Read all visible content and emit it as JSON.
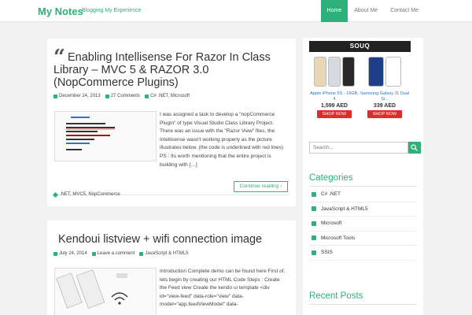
{
  "header": {
    "brand": "My Notes",
    "tagline": "Blogging My Experience",
    "nav": [
      {
        "label": "Home",
        "active": true
      },
      {
        "label": "About Me",
        "active": false
      },
      {
        "label": "Contact Me",
        "active": false
      }
    ]
  },
  "posts": [
    {
      "title": "Enabling Intellisense For Razor In Class Library – MVC 5 & RAZOR 3.0 (NopCommerce Plugins)",
      "date": "December 24, 2013",
      "comments": "27 Comments",
      "categories": "C# .NET, Microsoft",
      "excerpt": "I was assigned a task to develop a \"nopCommerce Plugin\" of type Visual Studio Class Library Project. There was an issue with the \"Razor View\" files, the Intellisense wasn't working properly as the picture illustrates below. (the code is underlined with red lines) PS : Its worth mentioning that the entire project is building with […]",
      "continue_label": "Continue reading",
      "tags": ".NET, MVC5, NopCommerce"
    },
    {
      "title": "Kendoui listview + wifi connection image",
      "date": "July 24, 2014",
      "comments": "Leave a comment",
      "categories": "JavaScript & HTML5",
      "excerpt": "Introduction Complete demo can be found here First of, lets begin by creating our HTML Code  Steps : Create the Feed view Create the kendo ui template   <div id=\"view-feed\" data-role=\"view\" data-model=\"app.feedViewModel\" data-"
    }
  ],
  "sidebar": {
    "ad": {
      "brand": "SOUQ",
      "products": [
        {
          "name": "Apple iPhone 5S - 16GB, 4",
          "price": "1,599 AED",
          "cta": "SHOP NOW"
        },
        {
          "name": "Samsung Galaxy J1 Dual Si...",
          "price": "339 AED",
          "cta": "SHOP NOW"
        }
      ]
    },
    "search_placeholder": "Search...",
    "categories_title": "Categories",
    "categories": [
      "C# .NET",
      "JavaScript & HTML5",
      "Microsoft",
      "Microsoft Tools",
      "SSIS"
    ],
    "recent_title": "Recent Posts"
  },
  "colors": {
    "accent": "#2db079",
    "ad_red": "#e32b2b",
    "link_blue": "#1a76c8"
  }
}
